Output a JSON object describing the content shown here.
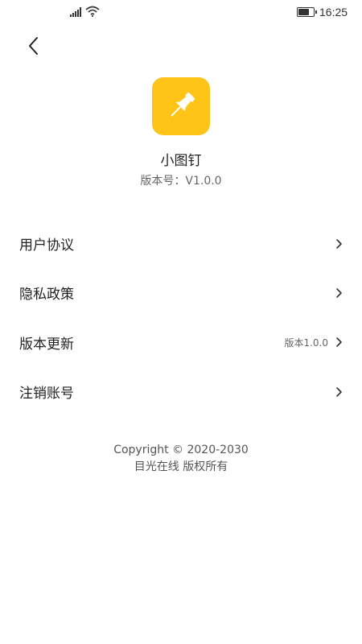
{
  "status_bar": {
    "time": "16:25",
    "battery_level": 0.75
  },
  "app": {
    "name": "小图钉",
    "version": "版本号：V1.0.0",
    "icon": "pushpin-icon",
    "icon_color": "#FFC417"
  },
  "menu": {
    "items": [
      {
        "label": "用户协议",
        "extra": ""
      },
      {
        "label": "隐私政策",
        "extra": ""
      },
      {
        "label": "版本更新",
        "extra": "版本1.0.0"
      },
      {
        "label": "注销账号",
        "extra": ""
      }
    ]
  },
  "footer": {
    "copyright": "Copyright © 2020-2030",
    "company": "目光在线 版权所有"
  }
}
